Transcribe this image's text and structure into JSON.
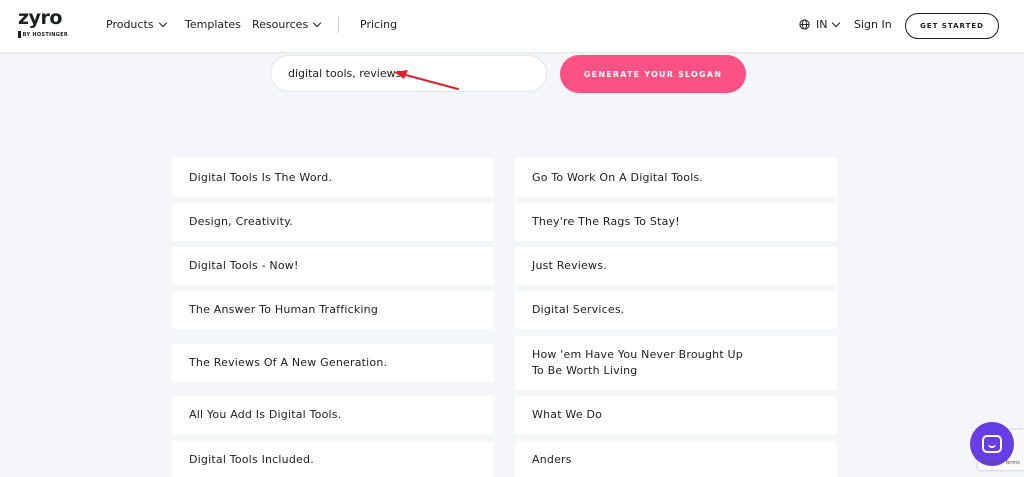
{
  "header": {
    "logo": {
      "word": "zyro",
      "sub": "BY HOSTINGER"
    },
    "nav": {
      "products": "Products",
      "templates": "Templates",
      "resources": "Resources",
      "pricing": "Pricing"
    },
    "language": "IN",
    "sign_in": "Sign In",
    "get_started": "GET STARTED"
  },
  "generator": {
    "input_value": "digital tools, reviews",
    "button_label": "GENERATE YOUR SLOGAN"
  },
  "slogans_left": [
    "Digital Tools Is The Word.",
    "Design, Creativity.",
    "Digital Tools - Now!",
    "The Answer To Human Trafficking",
    "The Reviews Of A New Generation.",
    "All You Add Is Digital Tools.",
    "Digital Tools Included."
  ],
  "slogans_right": [
    "Go To Work On A Digital Tools.",
    "They're The Rags To Stay!",
    "Just Reviews.",
    "Digital Services.",
    "How 'em Have You Never Brought Up To Be Worth Living",
    "What We Do",
    "Anders"
  ],
  "recaptcha": {
    "text": "Privacy - Terms"
  },
  "colors": {
    "accent": "#fc5185",
    "chat": "#673de6",
    "annotation_arrow": "#e0202a"
  }
}
